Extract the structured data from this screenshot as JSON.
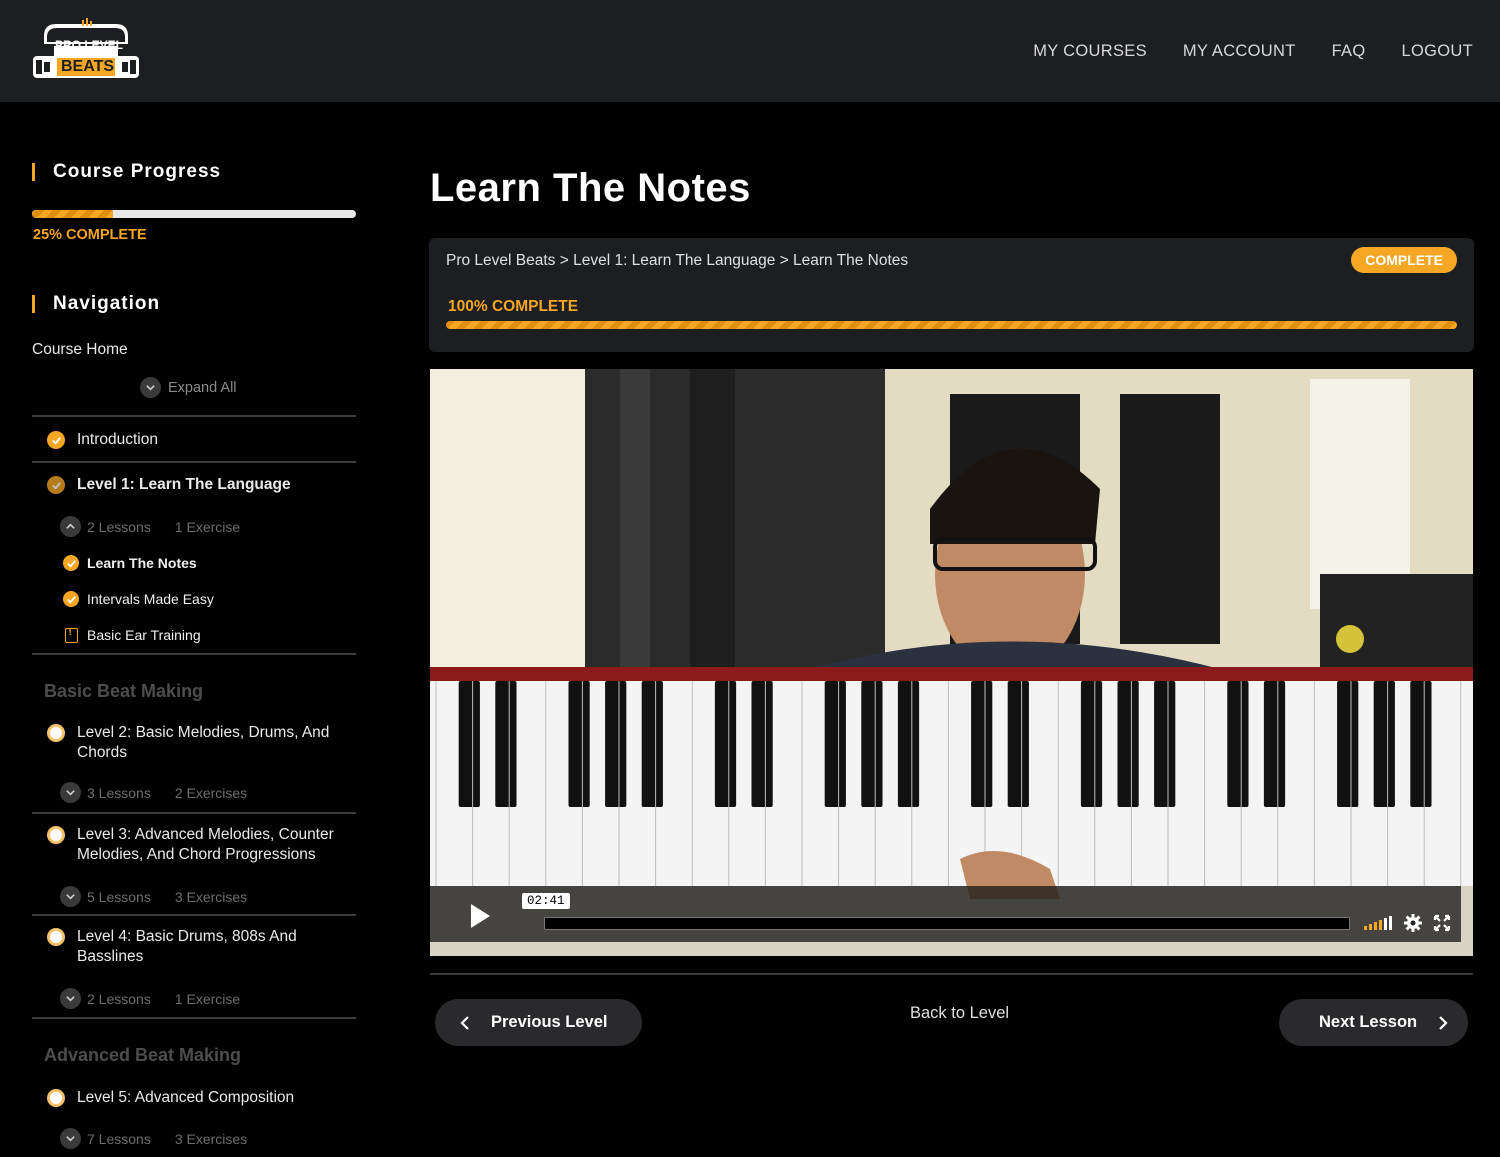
{
  "header": {
    "logo_top": "PRO LEVEL",
    "logo_bottom": "BEATS",
    "nav": [
      "MY COURSES",
      "MY ACCOUNT",
      "FAQ",
      "LOGOUT"
    ]
  },
  "sidebar": {
    "progress_title": "Course Progress",
    "progress_percent": 25,
    "progress_label": "25% COMPLETE",
    "navigation_title": "Navigation",
    "course_home": "Course Home",
    "expand_all": "Expand All",
    "introduction": "Introduction",
    "level1": {
      "title": "Level 1: Learn The Language",
      "lessons": "2 Lessons",
      "exercises": "1 Exercise",
      "items": [
        "Learn The Notes",
        "Intervals Made Easy",
        "Basic Ear Training"
      ]
    },
    "group_basic": "Basic Beat Making",
    "level2": {
      "title_line1": "Level 2: Basic Melodies, Drums, And",
      "title_line2": "Chords",
      "lessons": "3 Lessons",
      "exercises": "2 Exercises"
    },
    "level3": {
      "title_line1": "Level 3: Advanced Melodies, Counter",
      "title_line2": "Melodies, And Chord Progressions",
      "lessons": "5 Lessons",
      "exercises": "3 Exercises"
    },
    "level4": {
      "title_line1": "Level 4: Basic Drums, 808s And",
      "title_line2": "Basslines",
      "lessons": "2 Lessons",
      "exercises": "1 Exercise"
    },
    "group_advanced": "Advanced Beat Making",
    "level5": {
      "title": "Level 5: Advanced Composition",
      "lessons": "7 Lessons",
      "exercises": "3 Exercises"
    }
  },
  "main": {
    "title": "Learn The Notes",
    "breadcrumb": "Pro Level Beats > Level 1: Learn The Language > Learn The Notes",
    "status_badge": "COMPLETE",
    "lesson_progress_percent": 100,
    "lesson_progress_label": "100% COMPLETE",
    "video_time": "02:41",
    "prev_button": "Previous Level",
    "back_link": "Back to Level",
    "next_button": "Next Lesson"
  },
  "colors": {
    "accent": "#f5a623",
    "header_bg": "#1c1e22",
    "page_bg": "#000000"
  },
  "icons": [
    "check-icon",
    "chevron-down-icon",
    "chevron-up-icon",
    "play-icon",
    "volume-icon",
    "gear-icon",
    "fullscreen-icon",
    "chevron-left-icon",
    "chevron-right-icon",
    "exercise-doc-icon"
  ]
}
